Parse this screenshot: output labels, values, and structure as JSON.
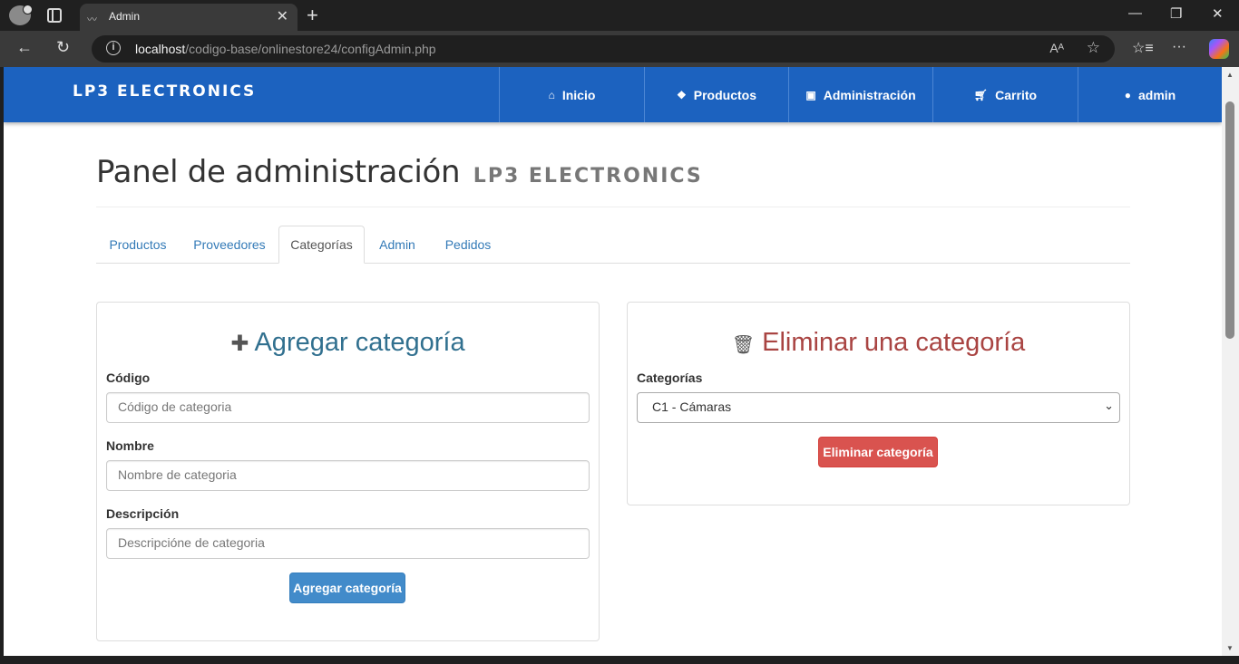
{
  "browser": {
    "tab_title": "Admin",
    "url_host": "localhost",
    "url_path": "/codigo-base/onlinestore24/configAdmin.php"
  },
  "navbar": {
    "brand": "LP3 ELECTRONICS",
    "items": [
      {
        "label": "Inicio",
        "icon": "home-icon"
      },
      {
        "label": "Productos",
        "icon": "dropbox-icon"
      },
      {
        "label": "Administración",
        "icon": "briefcase-icon"
      },
      {
        "label": "Carrito",
        "icon": "cart-icon"
      },
      {
        "label": "admin",
        "icon": "user-icon"
      }
    ]
  },
  "page": {
    "title": "Panel de administración",
    "subtitle": "LP3 ELECTRONICS"
  },
  "tabs": [
    {
      "label": "Productos",
      "active": false
    },
    {
      "label": "Proveedores",
      "active": false
    },
    {
      "label": "Categorías",
      "active": true
    },
    {
      "label": "Admin",
      "active": false
    },
    {
      "label": "Pedidos",
      "active": false
    }
  ],
  "add_panel": {
    "heading": "Agregar categoría",
    "code_label": "Código",
    "code_placeholder": "Código de categoria",
    "name_label": "Nombre",
    "name_placeholder": "Nombre de categoria",
    "desc_label": "Descripción",
    "desc_placeholder": "Descripcióne de categoria",
    "submit_label": "Agregar categoría"
  },
  "delete_panel": {
    "heading": "Eliminar una categoría",
    "select_label": "Categorías",
    "selected_option": "C1 - Cámaras",
    "submit_label": "Eliminar categoría"
  },
  "colors": {
    "navbar": "#1c62bf",
    "primary": "#428bca",
    "danger": "#d9534f",
    "heading_info": "#31708f",
    "heading_danger": "#a94442"
  }
}
